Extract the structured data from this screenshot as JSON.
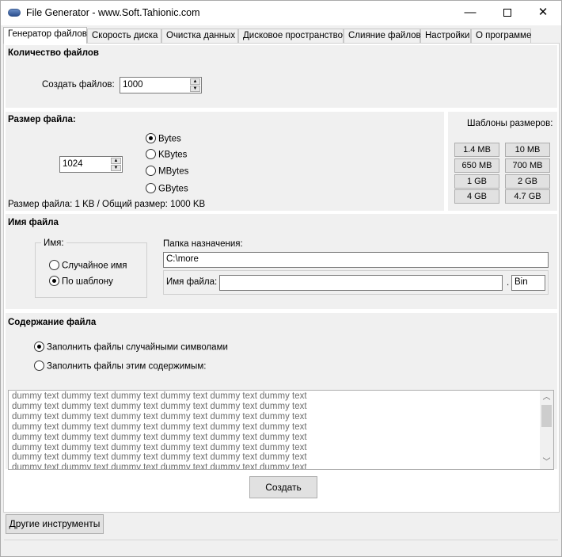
{
  "window": {
    "title": "File Generator  -  www.Soft.Tahionic.com",
    "minimize": "—",
    "close": "✕"
  },
  "tabs": [
    {
      "label": "Генератор файлов",
      "active": true
    },
    {
      "label": "Скорость диска"
    },
    {
      "label": "Очистка данных"
    },
    {
      "label": "Дисковое пространство"
    },
    {
      "label": "Слияние файлов"
    },
    {
      "label": "Настройки"
    },
    {
      "label": "О программе"
    }
  ],
  "file_count": {
    "title": "Количество файлов",
    "label": "Создать файлов:",
    "value": "1000"
  },
  "file_size": {
    "title": "Размер файла:",
    "value": "1024",
    "units": [
      {
        "label": "Bytes",
        "checked": true
      },
      {
        "label": "KBytes",
        "checked": false
      },
      {
        "label": "MBytes",
        "checked": false
      },
      {
        "label": "GBytes",
        "checked": false
      }
    ],
    "summary": "Размер файла: 1 KB / Общий размер: 1000 KB"
  },
  "presets": {
    "title": "Шаблоны размеров:",
    "items": [
      "1.4 MB",
      "10 MB",
      "650 MB",
      "700 MB",
      "1 GB",
      "2 GB",
      "4 GB",
      "4.7 GB"
    ]
  },
  "file_name": {
    "title": "Имя файла",
    "name_group_label": "Имя:",
    "options": [
      {
        "label": "Случайное имя",
        "checked": false
      },
      {
        "label": "По шаблону",
        "checked": true
      }
    ],
    "dest_label": "Папка назначения:",
    "dest_value": "C:\\more",
    "name_label": "Имя файла:",
    "name_value": "",
    "dot": ".",
    "ext_value": "Bin"
  },
  "content": {
    "title": "Содержание файла",
    "options": [
      {
        "label": "Заполнить файлы случайными символами",
        "checked": true
      },
      {
        "label": "Заполнить файлы этим содержимым:",
        "checked": false
      }
    ],
    "lines": [
      "dummy text dummy text dummy text dummy text dummy text dummy text",
      "dummy text dummy text dummy text dummy text dummy text dummy text",
      "dummy text dummy text dummy text dummy text dummy text dummy text",
      "dummy text dummy text dummy text dummy text dummy text dummy text",
      "dummy text dummy text dummy text dummy text dummy text dummy text",
      "dummy text dummy text dummy text dummy text dummy text dummy text",
      "dummy text dummy text dummy text dummy text dummy text dummy text",
      "dummy text dummy text dummy text dummy text dummy text dummy text"
    ],
    "scroll_up": "︿",
    "scroll_down": "﹀"
  },
  "actions": {
    "create_label": "Создать",
    "other_tools_label": "Другие инструменты"
  }
}
